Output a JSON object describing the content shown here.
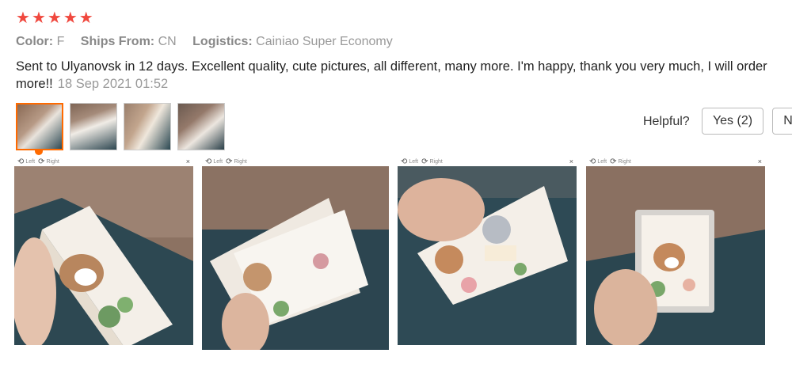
{
  "rating": {
    "stars": 5,
    "color": "#f0483e"
  },
  "meta": {
    "color_label": "Color:",
    "color_value": "F",
    "ships_label": "Ships From:",
    "ships_value": "CN",
    "logistics_label": "Logistics:",
    "logistics_value": "Cainiao Super Economy"
  },
  "review": {
    "text": "Sent to Ulyanovsk in 12 days. Excellent quality, cute pictures, all different, many more. I'm happy, thank you very much, I will order more!!",
    "date": "18 Sep 2021 01:52"
  },
  "feedback": {
    "helpful_label": "Helpful?",
    "yes_label": "Yes (2)",
    "no_label": "N"
  },
  "viewer": {
    "left_label": "Left",
    "right_label": "Right",
    "close_glyph": "×",
    "rotate_left_glyph": "⟲",
    "rotate_right_glyph": "⟳"
  },
  "colors": {
    "accent": "#ff6a00",
    "muted": "#999999"
  }
}
